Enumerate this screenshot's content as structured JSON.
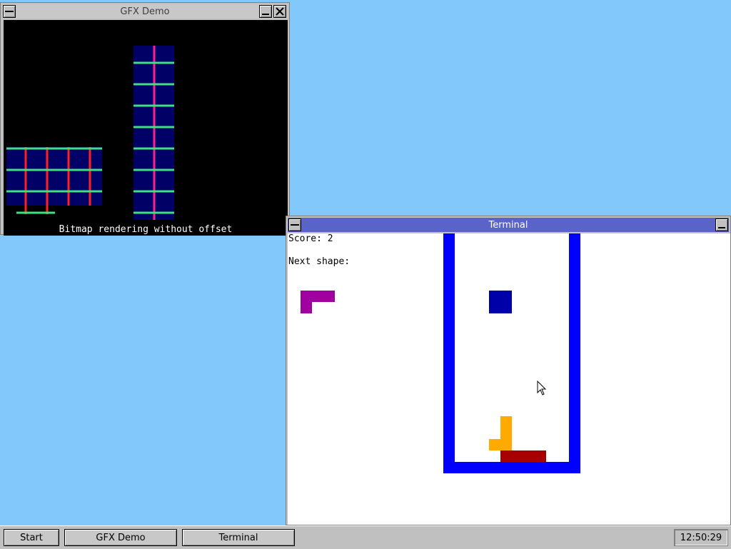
{
  "windows": {
    "gfx": {
      "title": "GFX Demo",
      "caption": "Bitmap rendering without offset"
    },
    "terminal": {
      "title": "Terminal",
      "score_line": "Score: 2",
      "next_shape_label": "Next shape:"
    }
  },
  "taskbar": {
    "start_label": "Start",
    "tasks": [
      "GFX Demo",
      "Terminal"
    ],
    "clock": "12:50:29"
  },
  "colors": {
    "desktop": "#82c8fa",
    "terminal_title": "#5a63c8",
    "well": "#0000ff",
    "next_piece": "#a000a0",
    "falling_piece": "#0000a8",
    "orange_piece": "#ffaa00",
    "red_piece": "#a80000"
  },
  "icons": [
    "system-menu-icon",
    "close-icon",
    "minimize-icon",
    "mouse-cursor-icon"
  ]
}
